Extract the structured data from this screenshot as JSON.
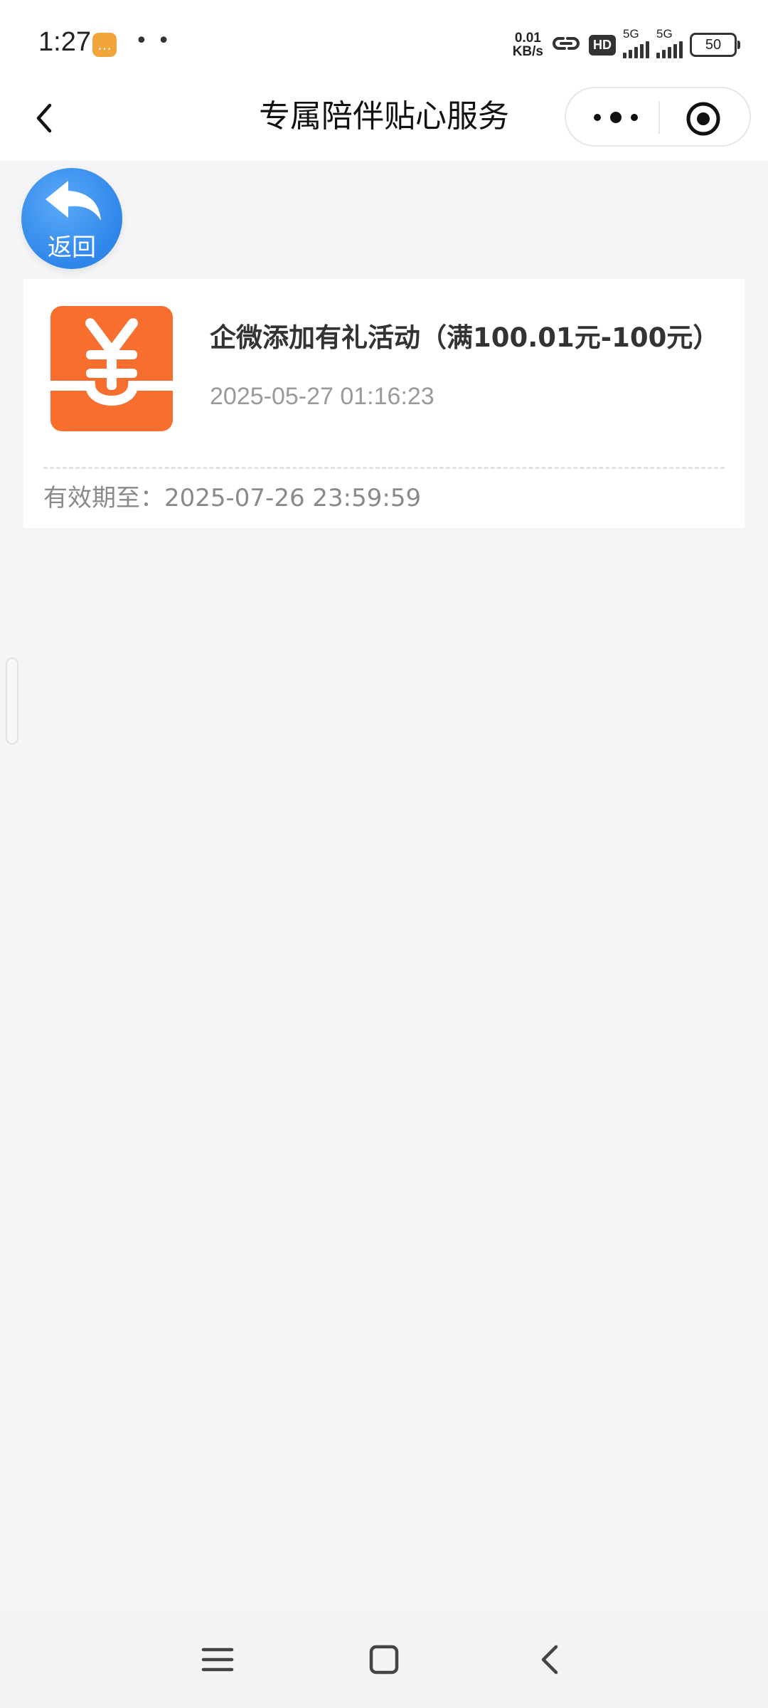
{
  "status_bar": {
    "time": "1:27",
    "dots": "• •",
    "net_speed_value": "0.01",
    "net_speed_unit": "KB/s",
    "hd_label": "HD",
    "signal1_label": "5G",
    "signal2_label": "5G",
    "battery_level": "50"
  },
  "nav": {
    "title": "专属陪伴贴心服务"
  },
  "float_back": {
    "label": "返回"
  },
  "card": {
    "title": "企微添加有礼活动（满100.01元-100元）",
    "date": "2025-05-27 01:16:23",
    "expiry": "有效期至：2025-07-26 23:59:59",
    "icon": "yen-tray-icon",
    "accent_color": "#f86e2f"
  }
}
